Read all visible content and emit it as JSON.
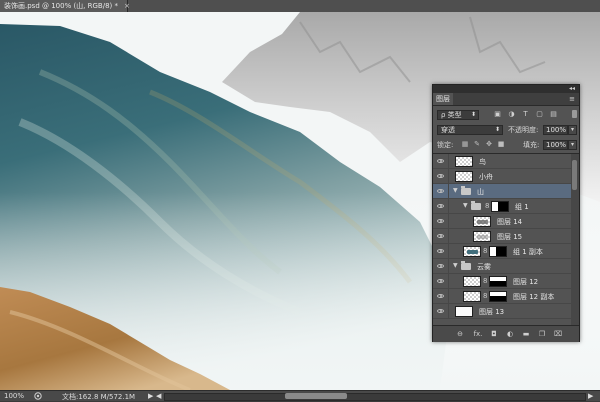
{
  "document_tab": {
    "title": "装饰画.psd @ 100% (山, RGB/8) *",
    "close": "×"
  },
  "status_bar": {
    "zoom": "100%",
    "doc_info": "文档:162.8 M/572.1M",
    "arrow": "▶",
    "scroll_left": "◀",
    "scroll_right": "▶",
    "horizontal_scroll_position": 0.5
  },
  "layers_panel": {
    "tab_label": "图层",
    "collapse_icon": "◂◂",
    "close_icon": "×",
    "menu_icon": "≡",
    "filter": {
      "kind_label": "ρ 类型",
      "icons": [
        "image-filter-icon",
        "adjustment-filter-icon",
        "type-filter-icon",
        "shape-filter-icon",
        "smart-object-filter-icon"
      ]
    },
    "blend_mode": "穿透",
    "opacity_label": "不透明度:",
    "opacity_value": "100%",
    "lock_label": "锁定:",
    "fill_label": "填充:",
    "fill_value": "100%",
    "layers": [
      {
        "name": "鸟",
        "type": "layer",
        "indent": 0,
        "selected": false
      },
      {
        "name": "小舟",
        "type": "layer",
        "indent": 0,
        "selected": false
      },
      {
        "name": "山",
        "type": "group",
        "indent": 0,
        "selected": true,
        "expanded": true
      },
      {
        "name": "组 1",
        "type": "group-with-mask",
        "indent": 1,
        "selected": false,
        "expanded": true
      },
      {
        "name": "图层 14",
        "type": "layer",
        "indent": 2,
        "selected": false
      },
      {
        "name": "图层 15",
        "type": "layer",
        "indent": 2,
        "selected": false
      },
      {
        "name": "组 1 副本",
        "type": "layer-with-mask",
        "indent": 1,
        "selected": false
      },
      {
        "name": "云雾",
        "type": "group",
        "indent": 0,
        "selected": false,
        "expanded": true
      },
      {
        "name": "图层 12",
        "type": "layer-with-mask",
        "indent": 1,
        "selected": false
      },
      {
        "name": "图层 12 副本",
        "type": "layer-with-mask",
        "indent": 1,
        "selected": false
      },
      {
        "name": "图层 13",
        "type": "layer-white",
        "indent": 0,
        "selected": false
      }
    ],
    "bottom_icons": [
      "link-layers-icon",
      "fx-icon",
      "add-mask-icon",
      "adjustment-layer-icon",
      "new-group-icon",
      "new-layer-icon",
      "delete-layer-icon"
    ],
    "fx_label": "fx."
  },
  "colors": {
    "teal": "#2f6170",
    "fog": "#e6eeee",
    "ochre": "#b98652",
    "rock": "#bdbdbd",
    "panel": "#535353",
    "selection": "#5a6b80"
  }
}
